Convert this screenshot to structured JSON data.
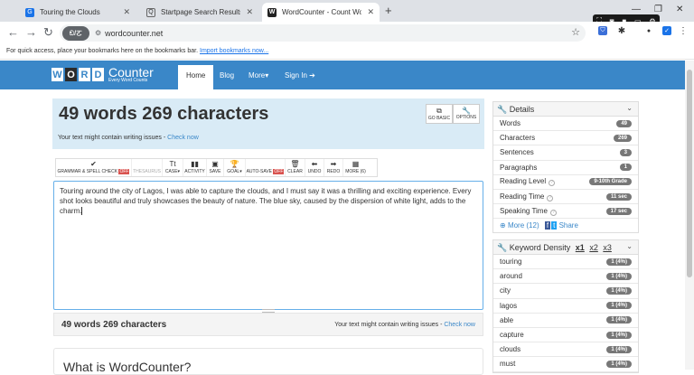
{
  "browser": {
    "tabs": [
      {
        "label": "Touring the Clouds",
        "icon": "G"
      },
      {
        "label": "Startpage Search Results",
        "icon": "Q"
      },
      {
        "label": "WordCounter - Count Words &",
        "icon": "W"
      }
    ],
    "url": "wordcounter.net",
    "pill": "ඞ/ㄛ",
    "bookmarks_text": "For quick access, place your bookmarks here on the bookmarks bar.",
    "bookmarks_link": "Import bookmarks now..."
  },
  "site": {
    "logo_letters": [
      "W",
      "O",
      "R",
      "D"
    ],
    "logo_counter": "Counter",
    "logo_tagline": "Every Word Counts",
    "nav": [
      "Home",
      "Blog",
      "More",
      "Sign In"
    ]
  },
  "hero": {
    "count": "49 words 269 characters",
    "warning": "Your text might contain writing issues - ",
    "warning_link": "Check now",
    "go_basic": "GO BASIC",
    "options": "OPTIONS"
  },
  "toolbar": [
    {
      "label": "GRAMMAR & SPELL CHECK",
      "badge": "OFF",
      "icon": "✔"
    },
    {
      "label": "THESAURUS",
      "icon": "",
      "disabled": true
    },
    {
      "label": "CASE▾",
      "icon": "Tt"
    },
    {
      "label": "ACTIVITY",
      "icon": "▮▮"
    },
    {
      "label": "SAVE",
      "icon": "▣"
    },
    {
      "label": "GOAL▾",
      "icon": "🏆"
    },
    {
      "label": "AUTO-SAVE",
      "badge": "OFF",
      "icon": ""
    },
    {
      "label": "CLEAR",
      "icon": "🗑"
    },
    {
      "label": "UNDO",
      "icon": "⬅"
    },
    {
      "label": "REDO",
      "icon": "➡"
    },
    {
      "label": "MORE (6)",
      "icon": "▦"
    }
  ],
  "editor": {
    "text": "Touring around the city of Lagos, I was able to capture the clouds, and I must say it was a thrilling and exciting experience. Every shot looks beautiful and truly showcases the beauty of nature. The blue sky, caused by the dispersion of white light, adds to the charm."
  },
  "status": {
    "count": "49 words 269 characters",
    "warning": "Your text might contain writing issues - ",
    "warning_link": "Check now"
  },
  "about": {
    "title": "What is WordCounter?"
  },
  "details": {
    "title": "Details",
    "rows": [
      {
        "label": "Words",
        "value": "49"
      },
      {
        "label": "Characters",
        "value": "269"
      },
      {
        "label": "Sentences",
        "value": "3"
      },
      {
        "label": "Paragraphs",
        "value": "1"
      },
      {
        "label": "Reading Level",
        "value": "9-10th Grade"
      },
      {
        "label": "Reading Time",
        "value": "11 sec"
      },
      {
        "label": "Speaking Time",
        "value": "17 sec"
      }
    ],
    "more": "More (12)",
    "share": "Share"
  },
  "density": {
    "title": "Keyword Density",
    "x1": "x1",
    "x2": "x2",
    "x3": "x3",
    "rows": [
      {
        "word": "touring",
        "value": "1 (4%)"
      },
      {
        "word": "around",
        "value": "1 (4%)"
      },
      {
        "word": "city",
        "value": "1 (4%)"
      },
      {
        "word": "lagos",
        "value": "1 (4%)"
      },
      {
        "word": "able",
        "value": "1 (4%)"
      },
      {
        "word": "capture",
        "value": "1 (4%)"
      },
      {
        "word": "clouds",
        "value": "1 (4%)"
      },
      {
        "word": "must",
        "value": "1 (4%)"
      }
    ]
  },
  "colors": {
    "brand": "#3a87c8",
    "hero_bg": "#d9ebf6",
    "badge": "#777777",
    "off": "#d9534f"
  }
}
